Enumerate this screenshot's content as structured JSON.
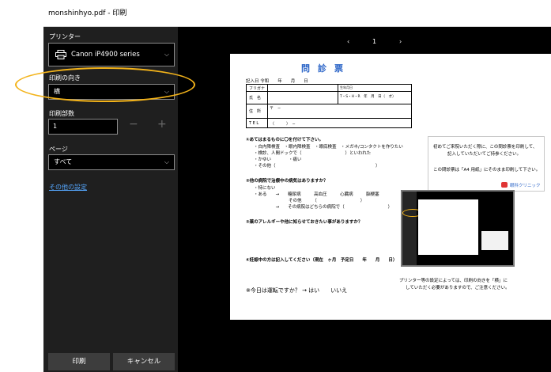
{
  "window": {
    "title": "monshinhyo.pdf - 印刷"
  },
  "left_pane": {
    "printer_label": "プリンター",
    "printer_value": "Canon iP4900 series",
    "orientation_label": "印刷の向き",
    "orientation_value": "横",
    "copies_label": "印刷部数",
    "copies_value": "1",
    "minus": "−",
    "plus": "+",
    "pages_label": "ページ",
    "pages_value": "すべて",
    "more_settings": "その他の設定",
    "print_button": "印刷",
    "cancel_button": "キャンセル"
  },
  "preview": {
    "prev": "‹",
    "page_number": "1",
    "next": "›",
    "doc_title": "問診票",
    "date_line": "記入日 令和　　年　　月　　日",
    "table": {
      "furigana": "フリガナ",
      "name": "氏　名",
      "address": "住　所",
      "tel": "T E L",
      "tel_value": "（　　　）　−",
      "birth_label": "生年月日",
      "birth_value": "T・S・H・R　年　月　日（　才）",
      "postal": "〒　−"
    },
    "q1": "①あてはまるものに〇を付けて下さい。",
    "q1_items": [
      "・白内障検査　・眼内障検査　・眼底検査　・メガネ/コンタクトを作りたい",
      "・検診、人間ドックで（　　　　　　　　　　）といわれた",
      "・かゆい　　　　・痛い",
      "・その他（　　　　　　　　　　　　　　　　　　　　　　　）"
    ],
    "q2": "②他の病院で治療中の病気はありますか？",
    "q2_items": [
      "・特にない",
      "・ある　　→　　糖尿病　　　高血圧　　　心臓病　　　脳梗塞",
      "　　　　　　　　その他　　　（　　　　　　　　　　）",
      "　　　　　→　　その病院はどちらの病院で（　　　　　　　　　　）"
    ],
    "q3": "③薬のアレルギーや他に知らせておきたい事がありますか？",
    "q4": "④妊娠中の方は記入してください（現在　ヶ月　予定日　　年　　月　　日）",
    "q5": "※今日は運転ですか？ → はい　　いいえ",
    "note_lines": [
      "初めてご来院いただく際に、この問診票を印刷して、",
      "記入していただいてご持参ください。",
      "この問診票は「A4 用紙」にそのまま印刷して下さい。"
    ],
    "clinic_name": "眼科クリニック",
    "caption_lines": [
      "プリンター等の設定によっては、印刷の向きを「横」に",
      "していただく必要がありますので、ご注意ください。"
    ]
  },
  "colors": {
    "accent_yellow": "#f3b31a",
    "title_blue": "#2d66c8",
    "link_blue": "#55a7ff",
    "dark_pane": "#1f1f1f"
  }
}
